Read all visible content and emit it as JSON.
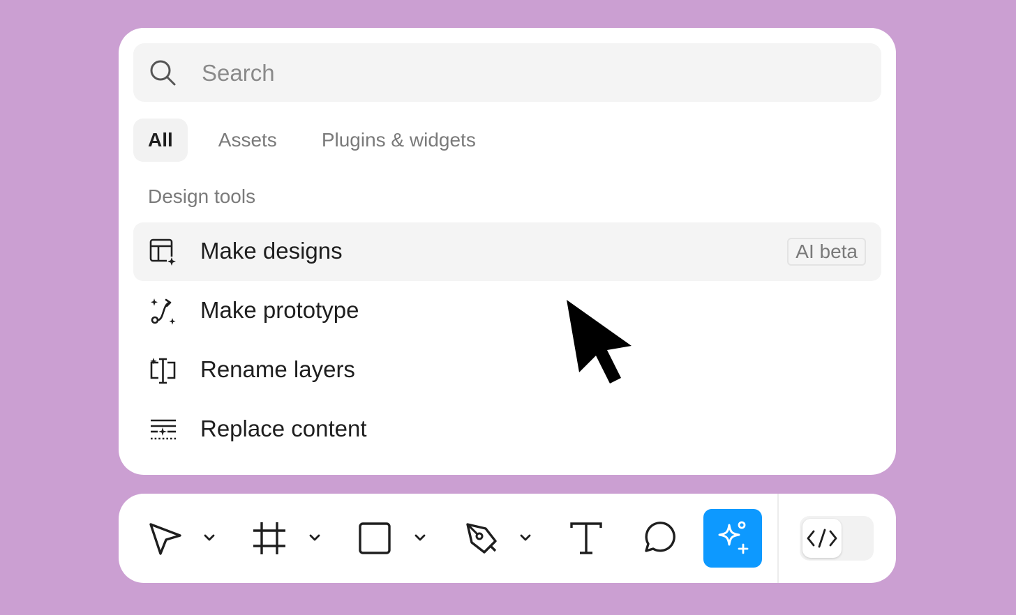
{
  "search": {
    "placeholder": "Search",
    "value": ""
  },
  "tabs": [
    {
      "label": "All",
      "active": true
    },
    {
      "label": "Assets",
      "active": false
    },
    {
      "label": "Plugins & widgets",
      "active": false
    }
  ],
  "section": {
    "label": "Design tools"
  },
  "items": [
    {
      "label": "Make designs",
      "icon": "layout-plus-icon",
      "badge": "AI beta",
      "highlighted": true
    },
    {
      "label": "Make prototype",
      "icon": "prototype-spark-icon"
    },
    {
      "label": "Rename layers",
      "icon": "rename-text-cursor-icon"
    },
    {
      "label": "Replace content",
      "icon": "replace-content-icon"
    }
  ],
  "toolbar": {
    "tools": [
      {
        "name": "move-tool",
        "icon": "arrow-pointer-icon",
        "has_menu": true
      },
      {
        "name": "frame-tool",
        "icon": "hash-frame-icon",
        "has_menu": true
      },
      {
        "name": "rectangle-tool",
        "icon": "square-icon",
        "has_menu": true
      },
      {
        "name": "pen-tool",
        "icon": "pen-nib-icon",
        "has_menu": true
      },
      {
        "name": "text-tool",
        "icon": "text-t-icon",
        "has_menu": false
      },
      {
        "name": "comment-tool",
        "icon": "speech-bubble-icon",
        "has_menu": false
      },
      {
        "name": "ai-tool",
        "icon": "sparkle-plus-icon",
        "active": true
      }
    ],
    "dev_mode": {
      "icon": "code-brackets-icon",
      "enabled": false
    }
  },
  "colors": {
    "background": "#cb9fd2",
    "panel": "#ffffff",
    "accent": "#0d99ff",
    "highlight": "#f4f4f4",
    "text": "#1e1e1e",
    "muted": "#7a7a7a"
  }
}
